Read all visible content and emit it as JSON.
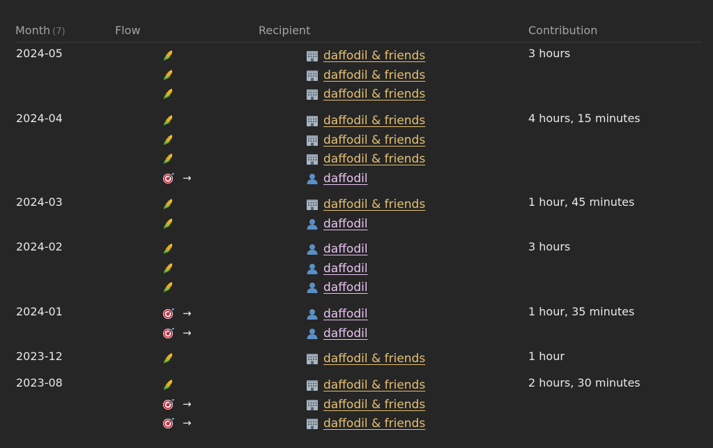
{
  "table": {
    "headers": {
      "month": "Month",
      "month_count": "(7)",
      "flow": "Flow",
      "recipient": "Recipient",
      "contribution": "Contribution"
    },
    "groups": [
      {
        "month": "2024-05",
        "contribution": "3 hours",
        "rows": [
          {
            "flow_icon": "corn-icon",
            "arrow": "",
            "recipient_icon": "building-icon",
            "recipient": "daffodil & friends",
            "recipient_type": "org"
          },
          {
            "flow_icon": "corn-icon",
            "arrow": "",
            "recipient_icon": "building-icon",
            "recipient": "daffodil & friends",
            "recipient_type": "org"
          },
          {
            "flow_icon": "corn-icon",
            "arrow": "",
            "recipient_icon": "building-icon",
            "recipient": "daffodil & friends",
            "recipient_type": "org"
          }
        ]
      },
      {
        "month": "2024-04",
        "contribution": "4 hours, 15 minutes",
        "rows": [
          {
            "flow_icon": "corn-icon",
            "arrow": "",
            "recipient_icon": "building-icon",
            "recipient": "daffodil & friends",
            "recipient_type": "org"
          },
          {
            "flow_icon": "corn-icon",
            "arrow": "",
            "recipient_icon": "building-icon",
            "recipient": "daffodil & friends",
            "recipient_type": "org"
          },
          {
            "flow_icon": "corn-icon",
            "arrow": "",
            "recipient_icon": "building-icon",
            "recipient": "daffodil & friends",
            "recipient_type": "org"
          },
          {
            "flow_icon": "target-icon",
            "arrow": "→",
            "recipient_icon": "person-icon",
            "recipient": "daffodil",
            "recipient_type": "person"
          }
        ]
      },
      {
        "month": "2024-03",
        "contribution": "1 hour, 45 minutes",
        "rows": [
          {
            "flow_icon": "corn-icon",
            "arrow": "",
            "recipient_icon": "building-icon",
            "recipient": "daffodil & friends",
            "recipient_type": "org"
          },
          {
            "flow_icon": "corn-icon",
            "arrow": "",
            "recipient_icon": "person-icon",
            "recipient": "daffodil",
            "recipient_type": "person"
          }
        ]
      },
      {
        "month": "2024-02",
        "contribution": "3 hours",
        "rows": [
          {
            "flow_icon": "corn-icon",
            "arrow": "",
            "recipient_icon": "person-icon",
            "recipient": "daffodil",
            "recipient_type": "person"
          },
          {
            "flow_icon": "corn-icon",
            "arrow": "",
            "recipient_icon": "person-icon",
            "recipient": "daffodil",
            "recipient_type": "person"
          },
          {
            "flow_icon": "corn-icon",
            "arrow": "",
            "recipient_icon": "person-icon",
            "recipient": "daffodil",
            "recipient_type": "person"
          }
        ]
      },
      {
        "month": "2024-01",
        "contribution": "1 hour, 35 minutes",
        "rows": [
          {
            "flow_icon": "target-icon",
            "arrow": "→",
            "recipient_icon": "person-icon",
            "recipient": "daffodil",
            "recipient_type": "person"
          },
          {
            "flow_icon": "target-icon",
            "arrow": "→",
            "recipient_icon": "person-icon",
            "recipient": "daffodil",
            "recipient_type": "person"
          }
        ]
      },
      {
        "month": "2023-12",
        "contribution": "1 hour",
        "rows": [
          {
            "flow_icon": "corn-icon",
            "arrow": "",
            "recipient_icon": "building-icon",
            "recipient": "daffodil & friends",
            "recipient_type": "org"
          }
        ]
      },
      {
        "month": "2023-08",
        "contribution": "2 hours, 30 minutes",
        "rows": [
          {
            "flow_icon": "corn-icon",
            "arrow": "",
            "recipient_icon": "building-icon",
            "recipient": "daffodil & friends",
            "recipient_type": "org"
          },
          {
            "flow_icon": "target-icon",
            "arrow": "→",
            "recipient_icon": "building-icon",
            "recipient": "daffodil & friends",
            "recipient_type": "org"
          },
          {
            "flow_icon": "target-icon",
            "arrow": "→",
            "recipient_icon": "building-icon",
            "recipient": "daffodil & friends",
            "recipient_type": "org"
          }
        ]
      }
    ]
  },
  "colors": {
    "background": "#262626",
    "header_text": "#a3a3a3",
    "body_text": "#e8e8e8",
    "org_link": "#e6c172",
    "person_link": "#e8c3f2",
    "divider": "#3d3d3d"
  }
}
